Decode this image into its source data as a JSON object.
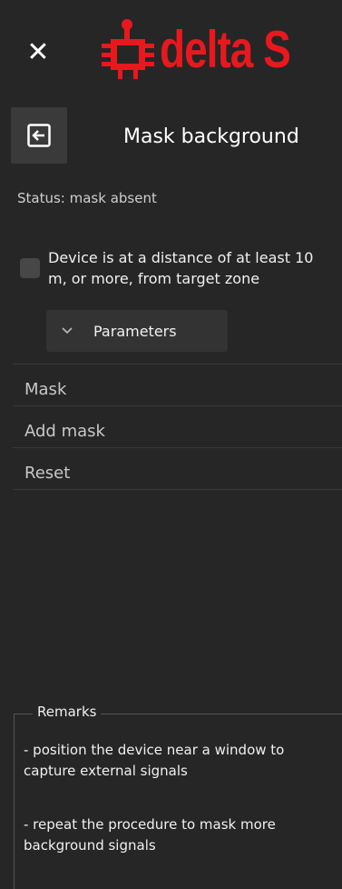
{
  "header": {
    "close_icon": "close-icon",
    "logo_text": "delta S",
    "logo_color": "#e8181e"
  },
  "title_bar": {
    "back_icon": "back-arrow-icon",
    "title": "Mask background"
  },
  "status": {
    "text": "Status: mask absent"
  },
  "distance_checkbox": {
    "checked": false,
    "label": "Device is at a distance of at least 10 m, or more, from target zone"
  },
  "parameters": {
    "label": "Parameters",
    "icon": "chevron-down-icon",
    "expanded": false
  },
  "menu": {
    "items": [
      {
        "label": "Mask"
      },
      {
        "label": "Add mask"
      },
      {
        "label": "Reset"
      }
    ]
  },
  "remarks": {
    "title": "Remarks",
    "items": [
      "- position the device near a window to capture external signals",
      "- repeat the procedure to mask more background signals"
    ]
  }
}
